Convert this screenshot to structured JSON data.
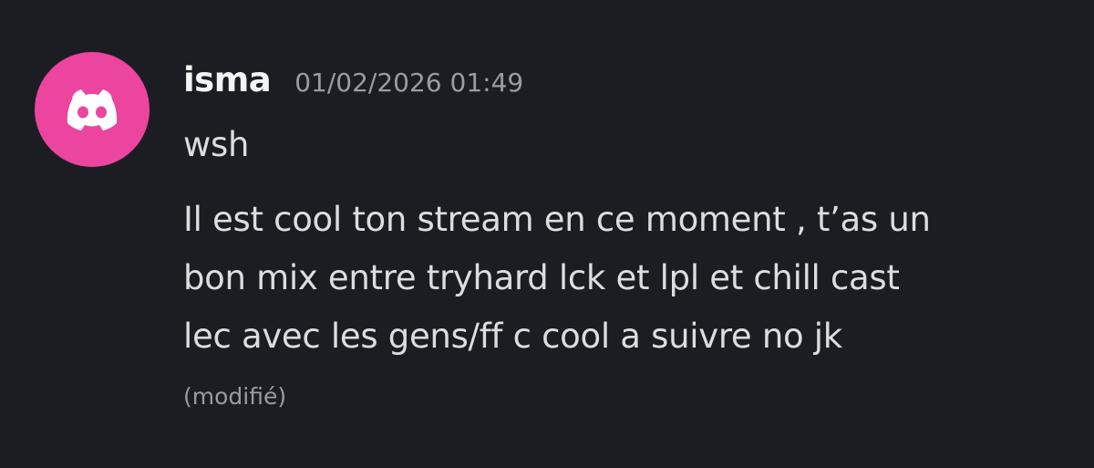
{
  "message": {
    "avatar_icon": "discord-logo-icon",
    "avatar_color": "#eb459f",
    "username": "isma",
    "timestamp": "01/02/2026 01:49",
    "lines": [
      "wsh",
      "Il est cool ton stream en ce moment , t’as un",
      "bon mix entre tryhard lck et lpl et chill cast",
      "lec avec les gens/ff c cool a suivre no jk"
    ],
    "edited_label": "(modifié)"
  }
}
